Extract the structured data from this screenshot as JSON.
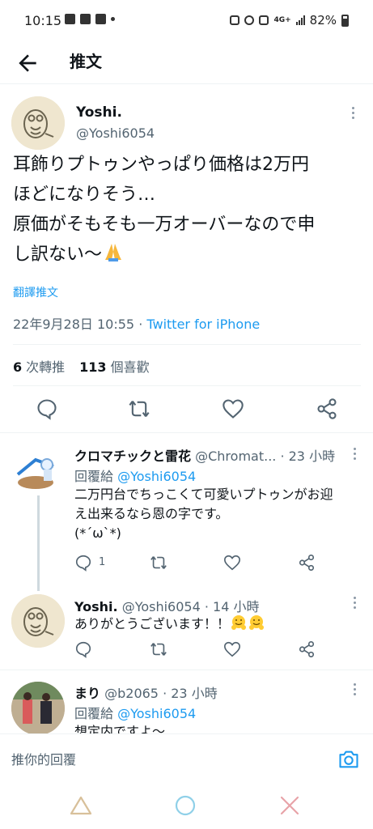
{
  "status_bar": {
    "time": "10:15",
    "left_icons": [
      "line-icon",
      "gallery-icon",
      "notification-icon"
    ],
    "network": "4G+",
    "battery": "82%"
  },
  "header": {
    "title": "推文"
  },
  "main_tweet": {
    "name": "Yoshi.",
    "handle": "@Yoshi6054",
    "text": "耳飾りプトゥンやっぱり価格は2万円\nほどになりそう…\n原価がそもそも一万オーバーなので申\nし訳ない〜",
    "emoji": "folded-hands",
    "translate": "翻譯推文",
    "datetime": "22年9月28日 10:55",
    "separator": " · ",
    "source": "Twitter for iPhone",
    "retweets_count": "6",
    "retweets_label": "次轉推",
    "likes_count": "113",
    "likes_label": "個喜歡"
  },
  "replies": [
    {
      "name": "クロマチックと雷花",
      "handle": "@Chromat...",
      "time": "· 23 小時",
      "reply_prefix": "回覆給",
      "reply_to": "@Yoshi6054",
      "text": "二万円台でちっこくて可愛いプトゥンがお迎\nえ出来るなら恩の字です。\n(*´ω`*)",
      "reply_count": "1"
    },
    {
      "name": "Yoshi.",
      "handle": "@Yoshi6054",
      "time": "· 14 小時",
      "text": "ありがとうございます！！"
    },
    {
      "name": "まり",
      "handle": "@b2065",
      "time": "· 23 小時",
      "reply_prefix": "回覆給",
      "reply_to": "@Yoshi6054",
      "text": "想定内ですよ〜"
    }
  ],
  "composer": {
    "placeholder": "推你的回覆"
  },
  "colors": {
    "accent": "#1d9bf0",
    "secondary_text": "#536471",
    "divider": "#eff3f4"
  }
}
